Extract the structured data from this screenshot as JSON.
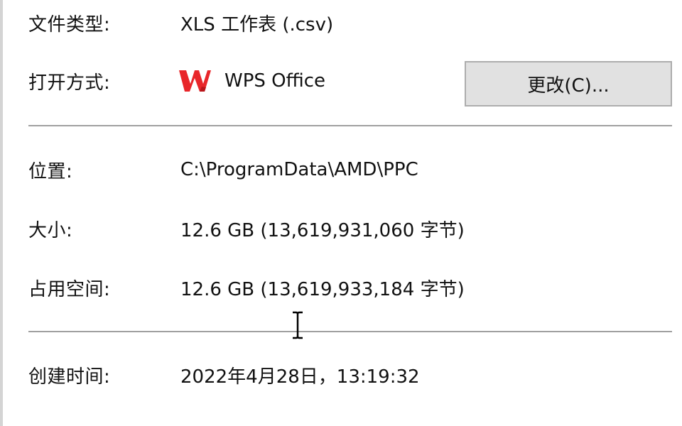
{
  "properties": {
    "file_type": {
      "label": "文件类型:",
      "value": "XLS 工作表 (.csv)"
    },
    "opens_with": {
      "label": "打开方式:",
      "app": "WPS Office",
      "icon": "wps-office-icon",
      "change_button": "更改(C)..."
    },
    "location": {
      "label": "位置:",
      "value": "C:\\ProgramData\\AMD\\PPC"
    },
    "size": {
      "label": "大小:",
      "value": "12.6 GB (13,619,931,060 字节)"
    },
    "size_on_disk": {
      "label": "占用空间:",
      "value": "12.6 GB (13,619,933,184 字节)"
    },
    "created": {
      "label": "创建时间:",
      "value": "2022年4月28日，13:19:32"
    }
  },
  "colors": {
    "wps_red": "#e8262a",
    "button_bg": "#e1e1e1",
    "button_border": "#adadad",
    "separator": "#a0a0a0"
  }
}
